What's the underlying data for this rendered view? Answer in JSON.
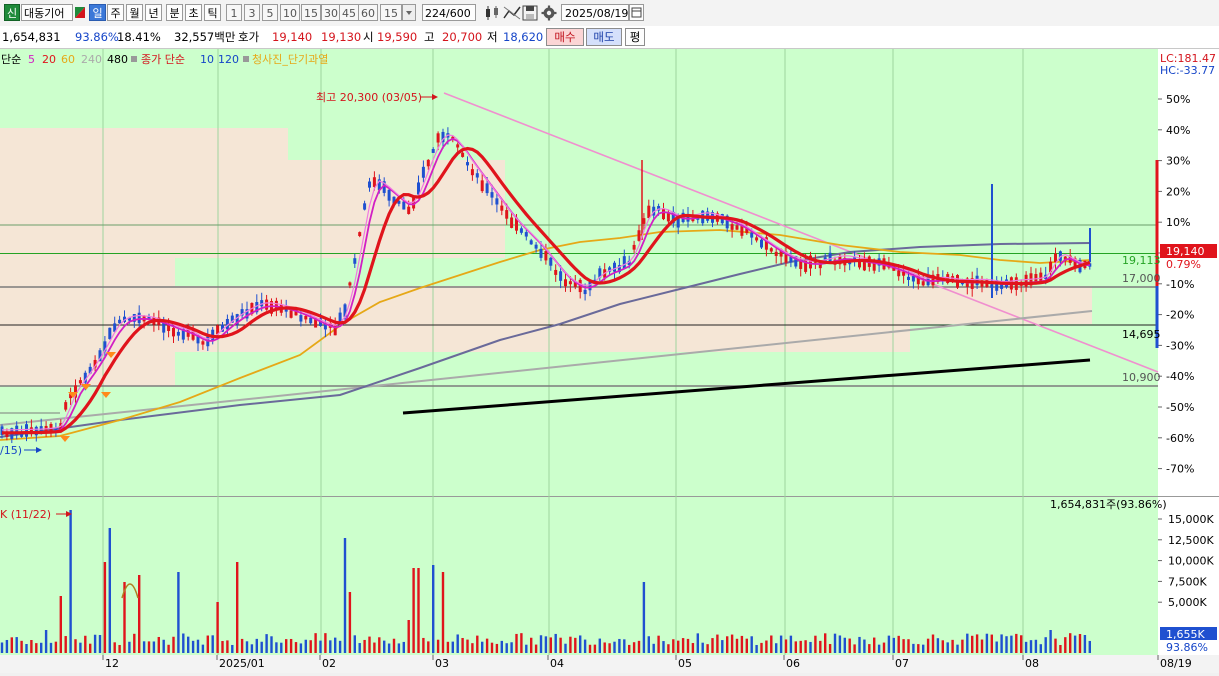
{
  "toolbar": {
    "new_btn": "신",
    "stock_name": "대동기어",
    "periods": [
      "일",
      "주",
      "월",
      "년",
      "분",
      "초",
      "틱"
    ],
    "selected_period": "일",
    "intervals": [
      "1",
      "3",
      "5",
      "10",
      "15",
      "30",
      "45",
      "60"
    ],
    "interval_value": "15",
    "count_value": "224",
    "count_total": "/600",
    "date_value": "2025/08/19"
  },
  "info": {
    "volume": "1,654,831",
    "ratio": "93.86%",
    "turnover": "18.41%",
    "amount": "32,557백만",
    "quote_label": "호가",
    "ask": "19,140",
    "bid": "19,130",
    "open_label": "시",
    "open": "19,590",
    "high_label": "고",
    "high": "20,700",
    "low_label": "저",
    "low": "18,620",
    "buy_btn": "매수",
    "sell_btn": "매도",
    "eval_btn": "평"
  },
  "legend": {
    "prefix": "단순",
    "ma": [
      "5",
      "20",
      "60",
      "240",
      "480"
    ],
    "vol_prefix": "종가 단순",
    "vol_ma": [
      "10",
      "120"
    ],
    "extra": "청사진_단기과열"
  },
  "colors": {
    "ma5": "#e0141c",
    "ma20": "#d21fc4",
    "ma60": "#e6a817",
    "ma240": "#aaaaaa",
    "ma480": "#000000",
    "up": "#e0141c",
    "down": "#1f50d0",
    "bg": "#ccffcc",
    "zone": "#f5e6d6"
  },
  "right_axis": {
    "lc": "LC:181.47",
    "hc": "HC:-33.77",
    "price_tag": "19,140",
    "price_change": "0.79%",
    "levels": [
      "19,113",
      "17,000",
      "14,695",
      "10,900"
    ]
  },
  "annotations": {
    "high_label": "최고 20,300 (03/05)",
    "left_cut": "/15)",
    "vol_high": "K (11/22)",
    "vol_current": "1,654,831주(93.86%)",
    "vol_tag": "1,655K",
    "vol_tag_pct": "93.86%"
  },
  "chart_data": {
    "type": "candlestick",
    "x_axis": [
      "12",
      "2025/01",
      "02",
      "03",
      "04",
      "05",
      "06",
      "07",
      "08",
      "08/19"
    ],
    "y_axis_pct": [
      "50%",
      "40%",
      "30%",
      "20%",
      "10%",
      "0%",
      "-10%",
      "-20%",
      "-30%",
      "-40%",
      "-50%",
      "-60%",
      "-70%"
    ],
    "volume_axis": [
      "15,000K",
      "12,500K",
      "10,000K",
      "7,500K",
      "5,000K"
    ],
    "current_price": 19140,
    "period_high": 20300,
    "period_high_date": "03/05"
  }
}
